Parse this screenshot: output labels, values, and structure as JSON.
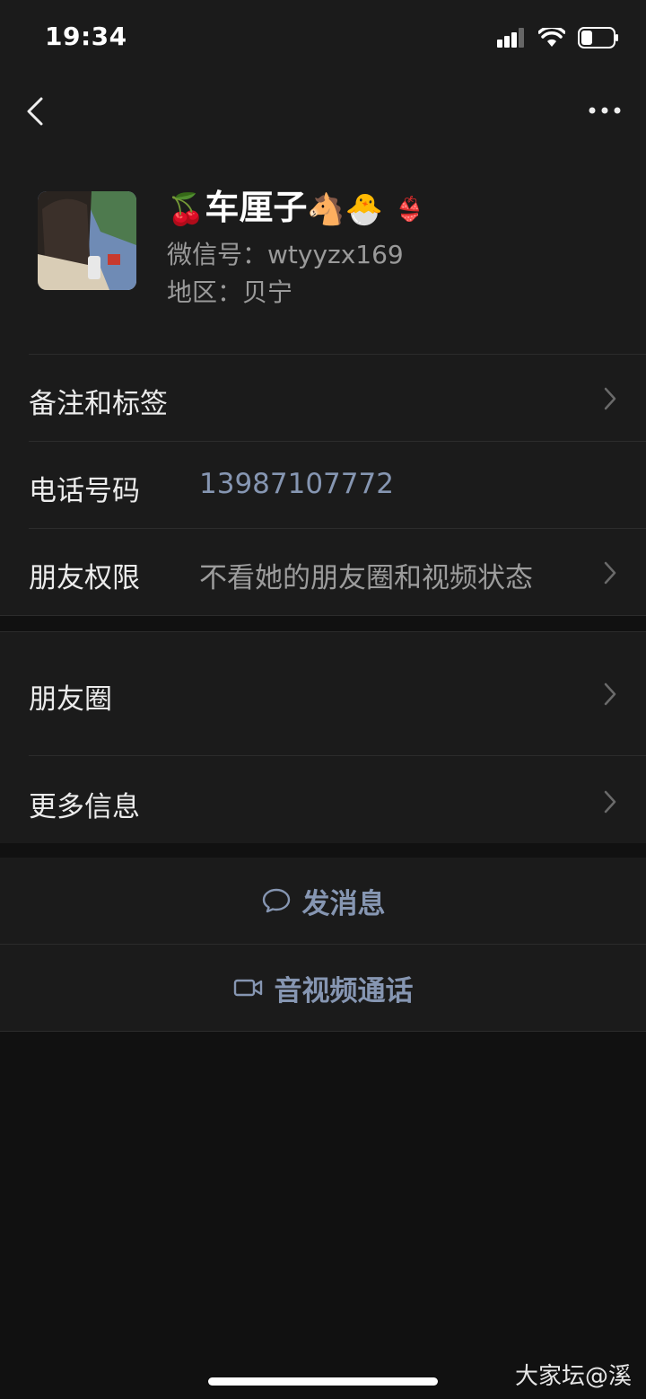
{
  "status_bar": {
    "time": "19:34"
  },
  "profile": {
    "name_prefix_emoji": "🍒",
    "name": "车厘子",
    "name_suffix_emoji": "🐴🐣",
    "badge_emoji": "👙",
    "wechat_id": "微信号：wtyyzx169",
    "region": "地区：贝宁"
  },
  "info_rows": [
    {
      "label": "备注和标签",
      "value": ""
    },
    {
      "label": "电话号码",
      "value": "13987107772"
    },
    {
      "label": "朋友权限",
      "value": "不看她的朋友圈和视频状态"
    }
  ],
  "section_rows": [
    {
      "label": "朋友圈"
    },
    {
      "label": "更多信息"
    }
  ],
  "actions": {
    "message": "发消息",
    "call": "音视频通话"
  },
  "watermark": "大家坛@溪",
  "colors": {
    "background": "#111111",
    "panel": "#1b1b1b",
    "link": "#8696b2"
  }
}
